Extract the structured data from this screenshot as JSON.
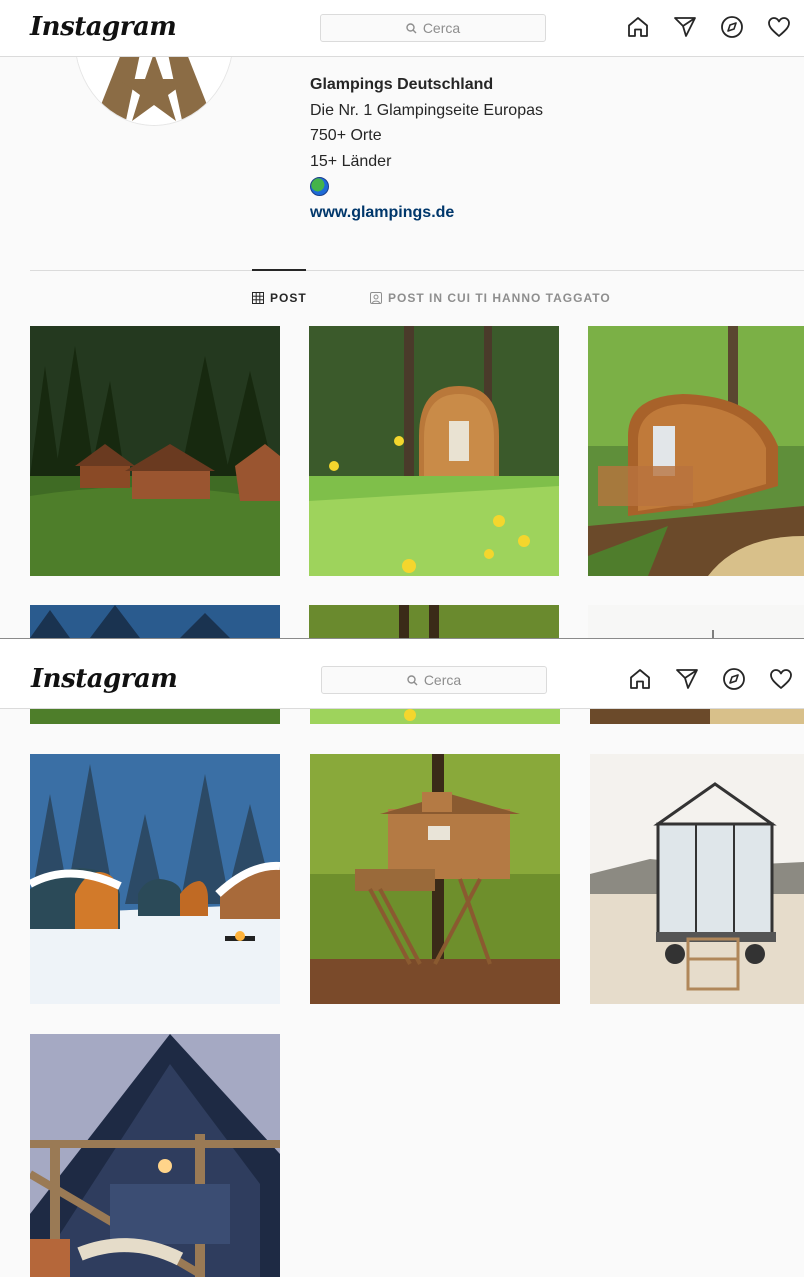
{
  "header": {
    "logo": "Instagram",
    "search_placeholder": "Cerca",
    "icons": [
      "home-icon",
      "direct-icon",
      "explore-icon",
      "activity-icon"
    ]
  },
  "profile": {
    "name": "Glampings Deutschland",
    "bio_lines": [
      "Die Nr. 1 Glampingseite Europas",
      "750+ Orte",
      "15+ Länder"
    ],
    "bio_emoji": "globe-icon",
    "website": "www.glampings.de"
  },
  "tabs": [
    {
      "label": "POST",
      "icon": "grid-icon",
      "active": true
    },
    {
      "label": "POST IN CUI TI HANNO TAGGATO",
      "icon": "tagged-icon",
      "active": false
    }
  ],
  "posts": [
    {
      "subject": "forest-cabins"
    },
    {
      "subject": "wooden-pod-meadow"
    },
    {
      "subject": "wooden-pod-garden"
    },
    {
      "subject": "snowy-pods"
    },
    {
      "subject": "treehouse"
    },
    {
      "subject": "glass-tiny-house"
    },
    {
      "subject": "a-frame-cabin"
    }
  ]
}
